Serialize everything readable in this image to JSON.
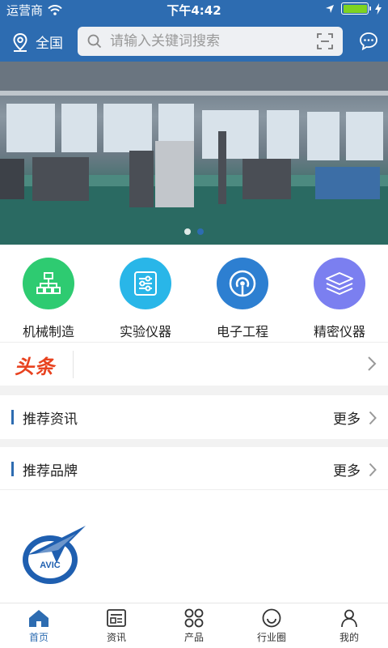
{
  "status": {
    "carrier": "运营商",
    "time": "下午4:42"
  },
  "header": {
    "location": "全国",
    "search_placeholder": "请输入关键词搜索"
  },
  "banner": {
    "slides": 2,
    "active_index": 0
  },
  "categories": [
    {
      "label": "机械制造",
      "color": "#2ecb71",
      "icon": "network-icon"
    },
    {
      "label": "实验仪器",
      "color": "#29b6e8",
      "icon": "sliders-icon"
    },
    {
      "label": "电子工程",
      "color": "#2d7fd1",
      "icon": "signal-icon"
    },
    {
      "label": "精密仪器",
      "color": "#7b7ff0",
      "icon": "layers-icon"
    }
  ],
  "headline": {
    "logo_text": "头条"
  },
  "sections": {
    "news": {
      "title": "推荐资讯",
      "more": "更多"
    },
    "brands": {
      "title": "推荐品牌",
      "more": "更多"
    }
  },
  "brand_logos": [
    {
      "name": "AVIC"
    }
  ],
  "tabbar": [
    {
      "label": "首页",
      "icon": "home-icon",
      "active": true
    },
    {
      "label": "资讯",
      "icon": "news-icon",
      "active": false
    },
    {
      "label": "产品",
      "icon": "grid-icon",
      "active": false
    },
    {
      "label": "行业圈",
      "icon": "smile-icon",
      "active": false
    },
    {
      "label": "我的",
      "icon": "user-icon",
      "active": false
    }
  ],
  "colors": {
    "primary": "#2d6cb1",
    "headline": "#e8421f"
  }
}
